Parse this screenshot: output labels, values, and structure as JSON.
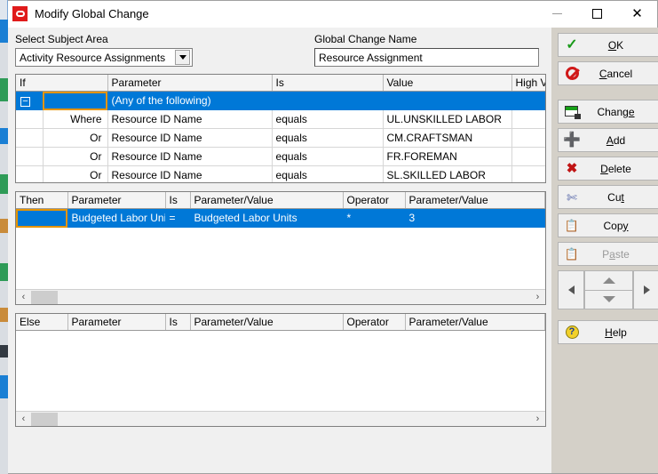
{
  "window": {
    "title": "Modify Global Change",
    "icon": "oracle-app-icon",
    "controls": {
      "minimize": "—",
      "maximize": "□",
      "close": "✕"
    }
  },
  "fields": {
    "subject_area_label": "Select Subject Area",
    "subject_area_value": "Activity Resource Assignments",
    "global_change_name_label": "Global Change Name",
    "global_change_name_value": "Resource Assignment"
  },
  "if_grid": {
    "headers": [
      "If",
      "",
      "Parameter",
      "Is",
      "Value",
      "High Value",
      ""
    ],
    "rows": [
      {
        "selected": true,
        "expander": "−",
        "cond": "",
        "parameter": "(Any of the following)",
        "is": "",
        "value": "",
        "high_value": "",
        "focus": "cond"
      },
      {
        "selected": false,
        "expander": "",
        "cond": "Where",
        "parameter": "Resource ID Name",
        "is": "equals",
        "value": "UL.UNSKILLED LABOR",
        "high_value": ""
      },
      {
        "selected": false,
        "expander": "",
        "cond": "Or",
        "parameter": "Resource ID Name",
        "is": "equals",
        "value": "CM.CRAFTSMAN",
        "high_value": ""
      },
      {
        "selected": false,
        "expander": "",
        "cond": "Or",
        "parameter": "Resource ID Name",
        "is": "equals",
        "value": "FR.FOREMAN",
        "high_value": ""
      },
      {
        "selected": false,
        "expander": "",
        "cond": "Or",
        "parameter": "Resource ID Name",
        "is": "equals",
        "value": "SL.SKILLED LABOR",
        "high_value": ""
      }
    ]
  },
  "then_grid": {
    "headers": [
      "Then",
      "Parameter",
      "Is",
      "Parameter/Value",
      "Operator",
      "Parameter/Value"
    ],
    "rows": [
      {
        "selected": true,
        "then": "",
        "parameter": "Budgeted Labor Units",
        "is": "=",
        "param_value": "Budgeted Labor Units",
        "operator": "*",
        "param_value2": "3",
        "focus": "then"
      }
    ]
  },
  "else_grid": {
    "headers": [
      "Else",
      "Parameter",
      "Is",
      "Parameter/Value",
      "Operator",
      "Parameter/Value"
    ],
    "rows": []
  },
  "buttons": [
    {
      "name": "ok",
      "label": "OK",
      "accel_pre": "",
      "accel": "O",
      "accel_post": "K",
      "icon": "check-icon",
      "enabled": true
    },
    {
      "name": "cancel",
      "label": "Cancel",
      "accel_pre": "",
      "accel": "C",
      "accel_post": "ancel",
      "icon": "ban-icon",
      "enabled": true
    },
    {
      "name": "change",
      "label": "Change",
      "accel_pre": "Chang",
      "accel": "e",
      "accel_post": "",
      "icon": "change-icon",
      "enabled": true
    },
    {
      "name": "add",
      "label": "Add",
      "accel_pre": "",
      "accel": "A",
      "accel_post": "dd",
      "icon": "plus-icon",
      "enabled": true
    },
    {
      "name": "delete",
      "label": "Delete",
      "accel_pre": "",
      "accel": "D",
      "accel_post": "elete",
      "icon": "delete-x-icon",
      "enabled": true
    },
    {
      "name": "cut",
      "label": "Cut",
      "accel_pre": "Cu",
      "accel": "t",
      "accel_post": "",
      "icon": "scissors-icon",
      "enabled": true
    },
    {
      "name": "copy",
      "label": "Copy",
      "accel_pre": "Cop",
      "accel": "y",
      "accel_post": "",
      "icon": "copy-icon",
      "enabled": true
    },
    {
      "name": "paste",
      "label": "Paste",
      "accel_pre": "P",
      "accel": "a",
      "accel_post": "ste",
      "icon": "paste-icon",
      "enabled": false
    },
    {
      "name": "help",
      "label": "Help",
      "accel_pre": "",
      "accel": "H",
      "accel_post": "elp",
      "icon": "help-icon",
      "enabled": true
    }
  ],
  "nav": {
    "left": "◀",
    "up": "▲",
    "down": "▼",
    "right": "▶"
  },
  "scrollbars": {
    "left_arrow": "‹",
    "right_arrow": "›"
  },
  "colors": {
    "selection_blue": "#0078d7",
    "focus_orange": "#e59400",
    "dialog_face": "#d4d0c8",
    "panel_face": "#f0f0f0",
    "title_icon_red": "#e01b1b"
  }
}
